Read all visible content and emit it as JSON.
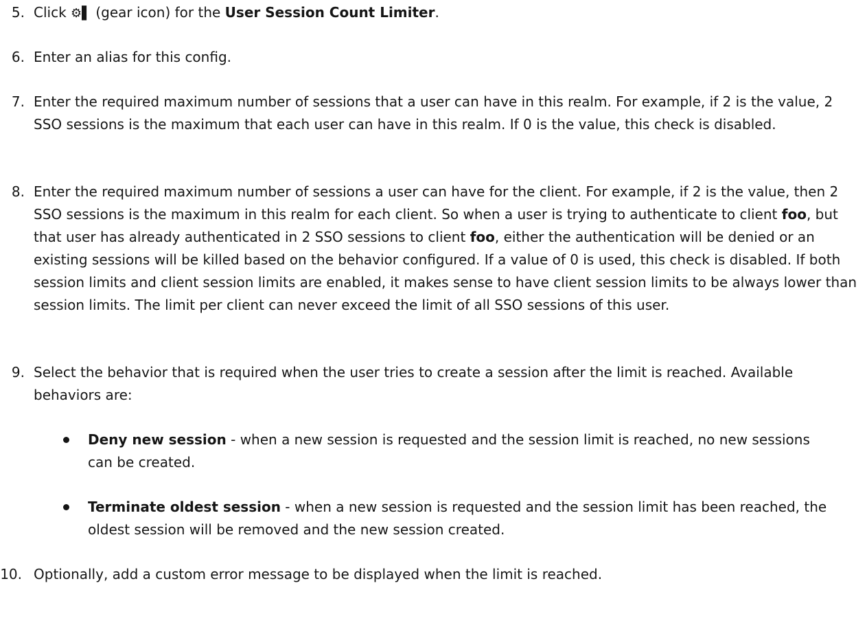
{
  "steps": [
    {
      "num": "5.",
      "pre": "Click ",
      "gear": "⚙▌",
      "mid": " (gear icon) for the ",
      "bold": "User Session Count Limiter",
      "post": "."
    },
    {
      "num": "6.",
      "text": "Enter an alias for this config."
    },
    {
      "num": "7.",
      "text": "Enter the required maximum number of sessions that a user can have in this realm. For example, if 2 is the value, 2 SSO sessions is the maximum that each user can have in this realm. If 0 is the value, this check is disabled."
    },
    {
      "num": "8.",
      "part1": "Enter the required maximum number of sessions a user can have for the client. For example, if 2 is the value, then 2 SSO sessions is the maximum in this realm for each client. So when a user is trying to authenticate to client ",
      "bold1": "foo",
      "part2": ", but that user has already authenticated in 2 SSO sessions to client ",
      "bold2": "foo",
      "part3": ", either the authentication will be denied or an existing sessions will be killed based on the behavior configured. If a value of 0 is used, this check is disabled. If both session limits and client session limits are enabled, it makes sense to have client session limits to be always lower than session limits. The limit per client can never exceed the limit of all SSO sessions of this user."
    },
    {
      "num": "9.",
      "text": "Select the behavior that is required when the user tries to create a session after the limit is reached. Available behaviors are:"
    },
    {
      "num": "10.",
      "text": "Optionally, add a custom error message to be displayed when the limit is reached."
    }
  ],
  "behaviors": [
    {
      "name": "Deny new session",
      "desc": " - when a new session is requested and the session limit is reached, no new sessions can be created."
    },
    {
      "name": "Terminate oldest session",
      "desc": " - when a new session is requested and the session limit has been reached, the oldest session will be removed and the new session created."
    }
  ]
}
